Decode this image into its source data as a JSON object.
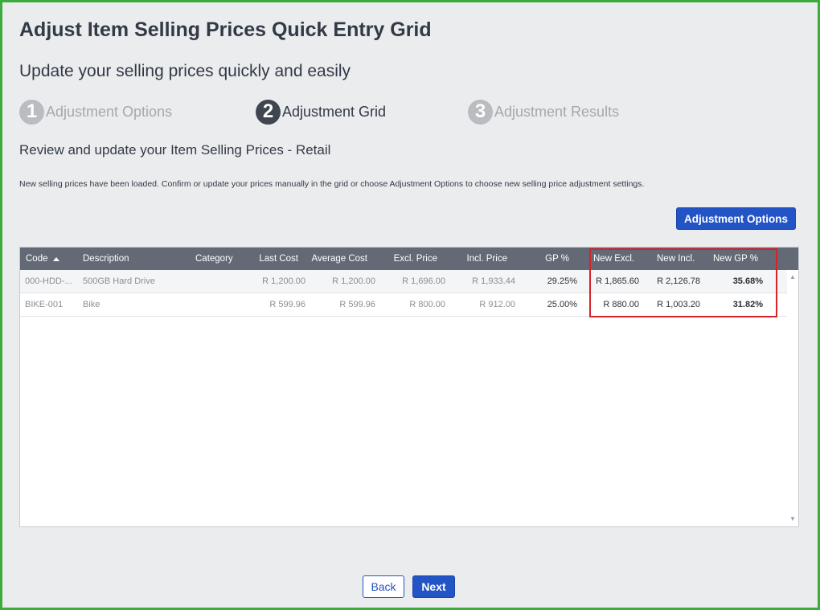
{
  "page": {
    "title": "Adjust Item Selling Prices Quick Entry Grid",
    "subtitle": "Update your selling prices quickly and easily"
  },
  "steps": [
    {
      "number": "1",
      "label": "Adjustment Options",
      "state": "inactive"
    },
    {
      "number": "2",
      "label": "Adjustment Grid",
      "state": "active"
    },
    {
      "number": "3",
      "label": "Adjustment Results",
      "state": "inactive"
    }
  ],
  "review_heading": "Review and update your Item Selling Prices - Retail",
  "info_text": "New selling prices have been loaded. Confirm or update your prices manually in the grid or choose Adjustment Options to choose new selling price adjustment settings.",
  "adjustment_options_label": "Adjustment Options",
  "grid": {
    "headers": {
      "code": "Code",
      "description": "Description",
      "category": "Category",
      "last_cost": "Last Cost",
      "average_cost": "Average Cost",
      "excl_price": "Excl. Price",
      "incl_price": "Incl. Price",
      "gp": "GP %",
      "new_excl": "New Excl.",
      "new_incl": "New Incl.",
      "new_gp": "New GP %"
    },
    "sort_icon": "sort-ascending-icon",
    "rows": [
      {
        "code": "000-HDD-...",
        "description": "500GB Hard Drive",
        "category": "",
        "last_cost": "R 1,200.00",
        "average_cost": "R 1,200.00",
        "excl_price": "R 1,696.00",
        "incl_price": "R 1,933.44",
        "gp": "29.25%",
        "new_excl": "R 1,865.60",
        "new_incl": "R 2,126.78",
        "new_gp": "35.68%"
      },
      {
        "code": "BIKE-001",
        "description": "Bike",
        "category": "",
        "last_cost": "R 599.96",
        "average_cost": "R 599.96",
        "excl_price": "R 800.00",
        "incl_price": "R 912.00",
        "gp": "25.00%",
        "new_excl": "R 880.00",
        "new_incl": "R 1,003.20",
        "new_gp": "31.82%"
      }
    ]
  },
  "buttons": {
    "back": "Back",
    "next": "Next"
  },
  "colors": {
    "primary": "#2254c5",
    "border_frame": "#3cad3c",
    "highlight": "#d6232a",
    "header_bg": "#636a76"
  }
}
